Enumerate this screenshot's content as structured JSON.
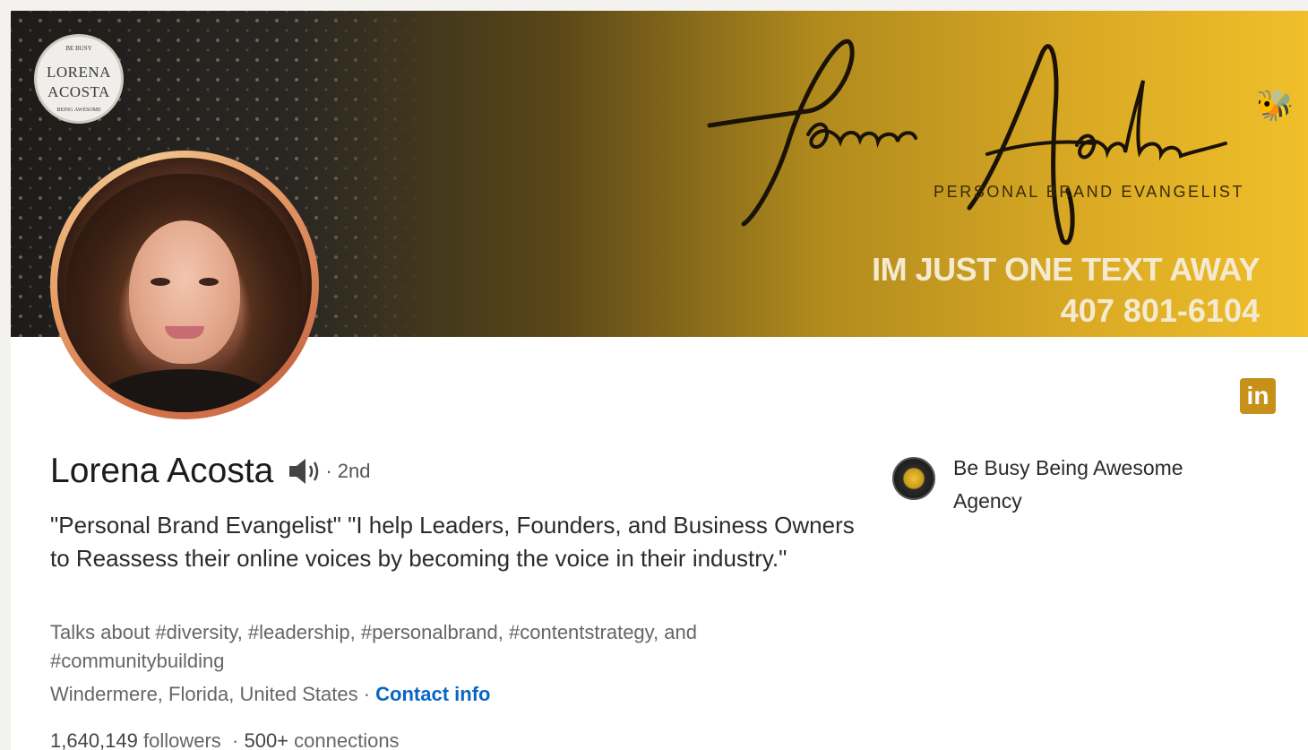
{
  "banner": {
    "seal_small_top": "BE BUSY",
    "seal_line1": "LORENA",
    "seal_line2": "ACOSTA",
    "seal_small_bottom": "BEING AWESOME",
    "script_name": "Lorena Acosta",
    "tagline": "PERSONAL BRAND EVANGELIST",
    "cta_line1": "IM JUST ONE TEXT AWAY",
    "cta_line2": "407 801-6104",
    "accent_gold": "#d9a924",
    "dark": "#1d1c1a"
  },
  "profile": {
    "name": "Lorena Acosta",
    "pronunciation_icon": "speaker-icon",
    "degree": "· 2nd",
    "headline": "\"Personal Brand Evangelist\" \"I help Leaders, Founders, and Business Owners to Reassess their online voices by becoming the voice in their industry.\"",
    "talks_about": "Talks about #diversity, #leadership, #personalbrand, #contentstrategy, and #communitybuilding",
    "location": "Windermere, Florida, United States",
    "separator": " · ",
    "contact_link": "Contact info",
    "followers_count": "1,640,149",
    "followers_label": " followers",
    "connections": "500+",
    "connections_label": " connections"
  },
  "company": {
    "name": "Be Busy Being Awesome Agency"
  },
  "linkedin_badge": "in",
  "colors": {
    "link": "#0a66c2",
    "badge": "#c79019"
  }
}
